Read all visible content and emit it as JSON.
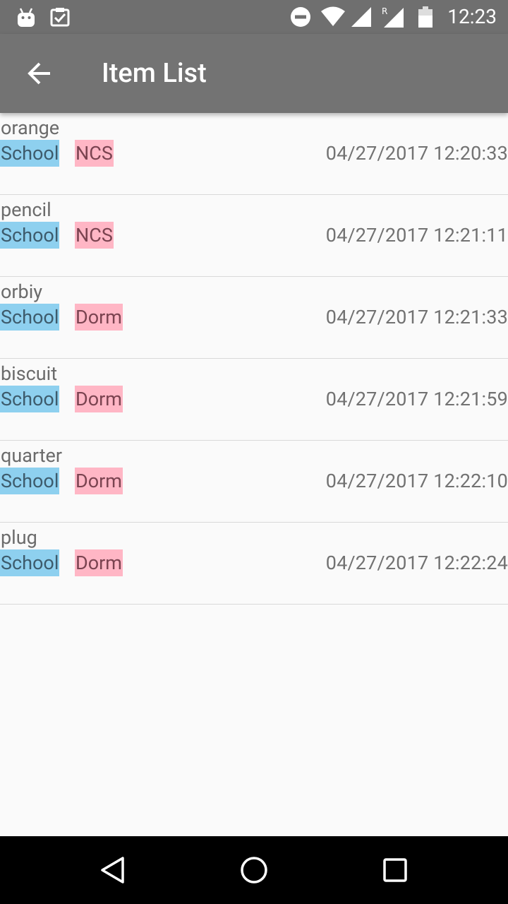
{
  "status_bar": {
    "time": "12:23",
    "icons": [
      "android-icon",
      "clipboard-check-icon",
      "do-not-disturb-icon",
      "wifi-icon",
      "signal-icon",
      "roaming-signal-icon",
      "battery-icon"
    ],
    "roaming_label": "R"
  },
  "app_bar": {
    "title": "Item List",
    "back_icon": "arrow-back-icon"
  },
  "items": [
    {
      "name": "orange",
      "category": "School",
      "location": "NCS",
      "timestamp": "04/27/2017 12:20:33"
    },
    {
      "name": "pencil",
      "category": "School",
      "location": "NCS",
      "timestamp": "04/27/2017 12:21:11"
    },
    {
      "name": "orbiy",
      "category": "School",
      "location": "Dorm",
      "timestamp": "04/27/2017 12:21:33"
    },
    {
      "name": "biscuit",
      "category": "School",
      "location": "Dorm",
      "timestamp": "04/27/2017 12:21:59"
    },
    {
      "name": "quarter",
      "category": "School",
      "location": "Dorm",
      "timestamp": "04/27/2017 12:22:10"
    },
    {
      "name": "plug",
      "category": "School",
      "location": "Dorm",
      "timestamp": "04/27/2017 12:22:24"
    }
  ],
  "colors": {
    "app_bar": "#737373",
    "status_bar": "#6f6f6f",
    "category_tag": "#8ed0ef",
    "location_tag": "#ffb6c5",
    "background": "#fafafa"
  },
  "nav_bar": {
    "icons": [
      "back-triangle-icon",
      "home-circle-icon",
      "recents-square-icon"
    ]
  }
}
